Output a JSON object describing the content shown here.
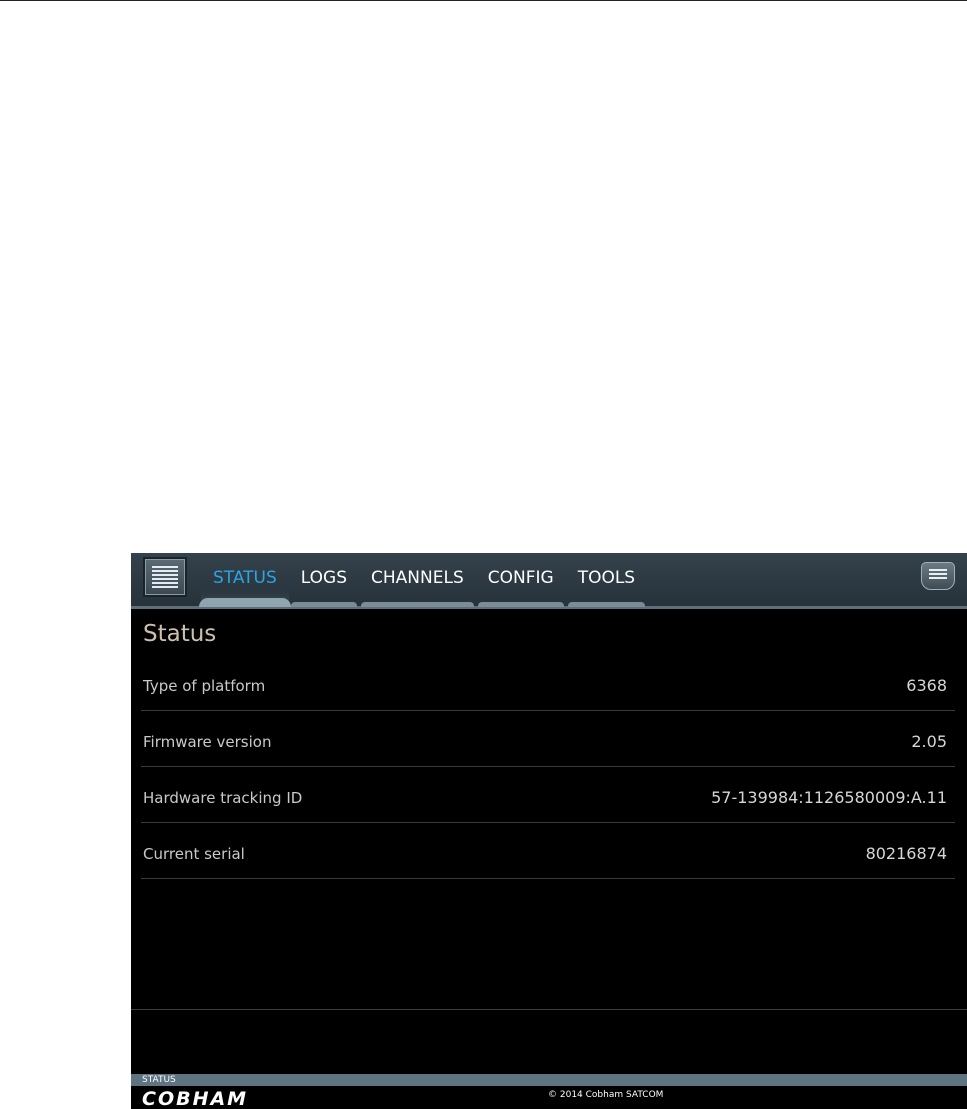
{
  "navigation": {
    "tabs": [
      {
        "label": "STATUS",
        "active": true
      },
      {
        "label": "LOGS",
        "active": false
      },
      {
        "label": "CHANNELS",
        "active": false
      },
      {
        "label": "CONFIG",
        "active": false
      },
      {
        "label": "TOOLS",
        "active": false
      }
    ],
    "menu_icon": "list-menu-icon",
    "messages_icon": "message-icon"
  },
  "page": {
    "title": "Status",
    "rows": [
      {
        "label": "Type of platform",
        "value": "6368"
      },
      {
        "label": "Firmware version",
        "value": "2.05"
      },
      {
        "label": "Hardware tracking ID",
        "value": "57-139984:1126580009:A.11"
      },
      {
        "label": "Current serial",
        "value": "80216874"
      }
    ]
  },
  "footer": {
    "status_label": "STATUS",
    "brand": "COBHAM",
    "copyright": "© 2014 Cobham SATCOM"
  },
  "colors": {
    "active_tab": "#2aa5e6",
    "title": "#cdc1ae",
    "background": "#000000",
    "status_strip": "#5e7480"
  }
}
